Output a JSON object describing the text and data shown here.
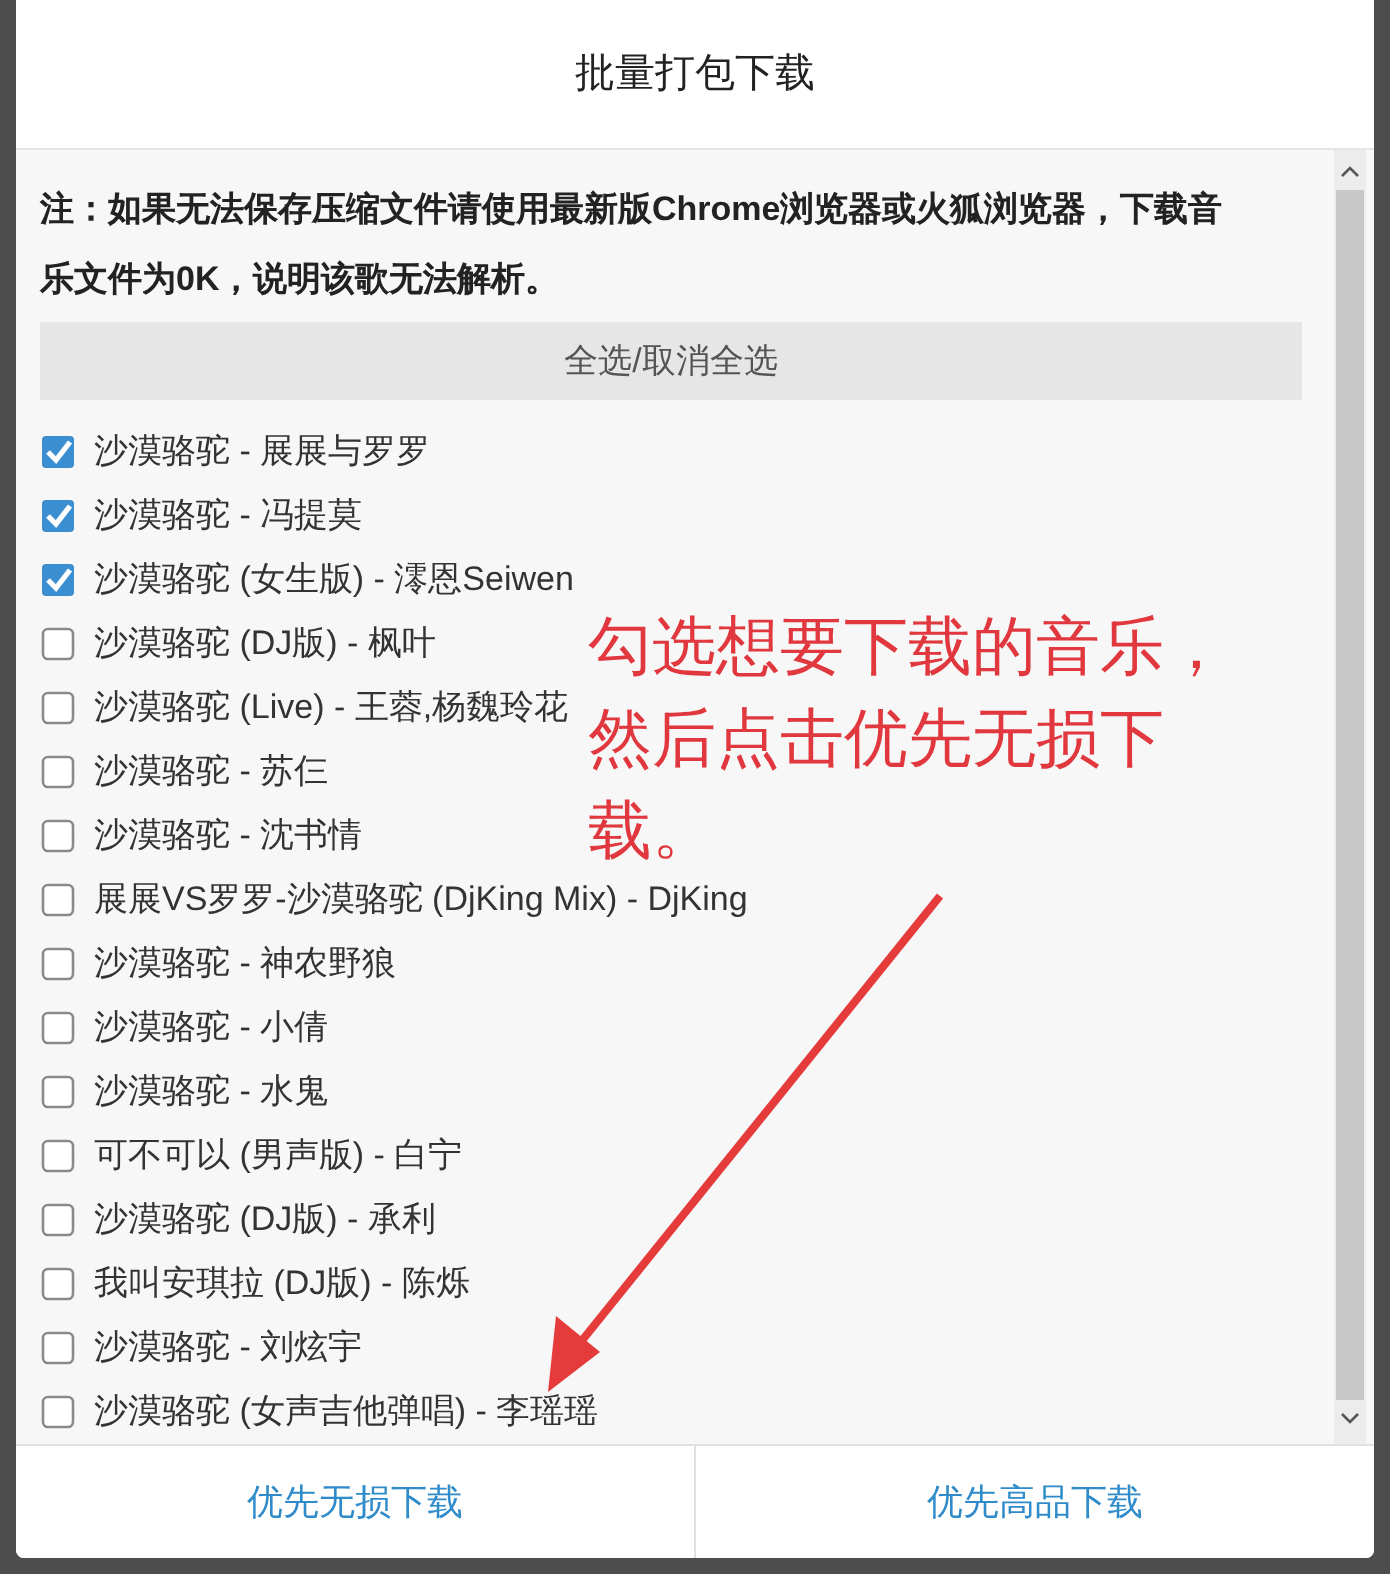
{
  "dialog": {
    "title": "批量打包下载"
  },
  "notice": "注：如果无法保存压缩文件请使用最新版Chrome浏览器或火狐浏览器，下载音乐文件为0K，说明该歌无法解析。",
  "select_all_button": "全选/取消全选",
  "songs": [
    {
      "label": "沙漠骆驼 - 展展与罗罗",
      "checked": true
    },
    {
      "label": "沙漠骆驼 - 冯提莫",
      "checked": true
    },
    {
      "label": "沙漠骆驼 (女生版) - 澪恩Seiwen",
      "checked": true
    },
    {
      "label": "沙漠骆驼 (DJ版) - 枫叶",
      "checked": false
    },
    {
      "label": "沙漠骆驼 (Live) - 王蓉,杨魏玲花",
      "checked": false
    },
    {
      "label": "沙漠骆驼 - 苏仨",
      "checked": false
    },
    {
      "label": "沙漠骆驼 - 沈书情",
      "checked": false
    },
    {
      "label": "展展VS罗罗-沙漠骆驼 (DjKing Mix) - DjKing",
      "checked": false
    },
    {
      "label": "沙漠骆驼 - 神农野狼",
      "checked": false
    },
    {
      "label": "沙漠骆驼 - 小倩",
      "checked": false
    },
    {
      "label": "沙漠骆驼 - 水鬼",
      "checked": false
    },
    {
      "label": "可不可以 (男声版) - 白宁",
      "checked": false
    },
    {
      "label": "沙漠骆驼 (DJ版) - 承利",
      "checked": false
    },
    {
      "label": "我叫安琪拉 (DJ版) - 陈烁",
      "checked": false
    },
    {
      "label": "沙漠骆驼 - 刘炫宇",
      "checked": false
    },
    {
      "label": "沙漠骆驼 (女声吉他弹唱) - 李瑶瑶",
      "checked": false
    }
  ],
  "annotation": "勾选想要下载的音乐，然后点击优先无损下载。",
  "footer_buttons": [
    "优先无损下载",
    "优先高品下载"
  ]
}
